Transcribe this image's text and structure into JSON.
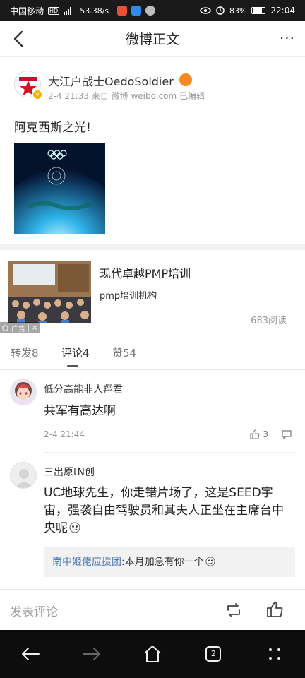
{
  "status_bar": {
    "carrier": "中国移动",
    "network_badge": "HD",
    "speed": "53.38/s",
    "battery": "83%",
    "time": "22:04",
    "app_icon_colors": [
      "#e8503a",
      "#2e8be8",
      "#bdbdbd"
    ]
  },
  "header": {
    "title": "微博正文",
    "back_icon": "back-arrow-icon",
    "more_icon": "more-dots-icon",
    "more_label": "···"
  },
  "post": {
    "author": "大江户战士OedoSoldier",
    "meta": "2-4 21:33 来自 微博 weibo.com 已编辑",
    "text": "阿克西斯之光!",
    "image_desc": "olympic-earth-image"
  },
  "ad": {
    "title": "现代卓越PMP培训",
    "subtitle": "pmp培训机构",
    "reads": "683阅读",
    "tag": "广告",
    "tag_close": "×"
  },
  "tabs": {
    "repost": "转发8",
    "comment": "评论4",
    "like": "赞54",
    "active": "comment"
  },
  "comments": [
    {
      "name": "低分高能非人翔君",
      "text": "共军有高达啊",
      "time": "2-4 21:44",
      "likes": "3"
    },
    {
      "name": "三出原tN创",
      "text": "UC地球先生，你走错片场了，这是SEED宇宙，强袭自由驾驶员和其夫人正坐在主席台中央呢",
      "reply": {
        "user": "南中姬佬应援团",
        "text": ":本月加急有你一个"
      }
    }
  ],
  "comment_bar": {
    "placeholder": "发表评论"
  },
  "nav": {
    "tab_count": "2"
  },
  "colors": {
    "link_blue": "#4d7ab4",
    "verified_yellow": "#f7b500",
    "crown_orange": "#f58b1f"
  }
}
